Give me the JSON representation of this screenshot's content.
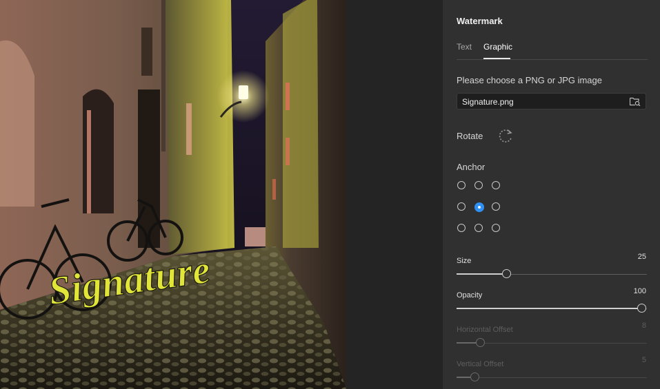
{
  "panel": {
    "title": "Watermark",
    "tabs": [
      {
        "label": "Text",
        "active": false
      },
      {
        "label": "Graphic",
        "active": true
      }
    ],
    "file_prompt": "Please choose a PNG or JPG image",
    "file_value": "Signature.png",
    "rotate_label": "Rotate",
    "anchor_label": "Anchor",
    "anchor_selected": "center",
    "sliders": [
      {
        "label": "Size",
        "value": "25",
        "fraction": 0.25,
        "enabled": true
      },
      {
        "label": "Opacity",
        "value": "100",
        "fraction": 1.0,
        "enabled": true
      },
      {
        "label": "Horizontal Offset",
        "value": "8",
        "fraction": 0.105,
        "enabled": false
      },
      {
        "label": "Vertical Offset",
        "value": "5",
        "fraction": 0.075,
        "enabled": false
      }
    ]
  },
  "preview": {
    "watermark_text": "Signature",
    "watermark_color": "#e1e53a"
  },
  "colors": {
    "accent": "#2f8ff5",
    "panel_bg": "#303030"
  },
  "icons": [
    "folder-search-icon",
    "rotate-icon"
  ]
}
